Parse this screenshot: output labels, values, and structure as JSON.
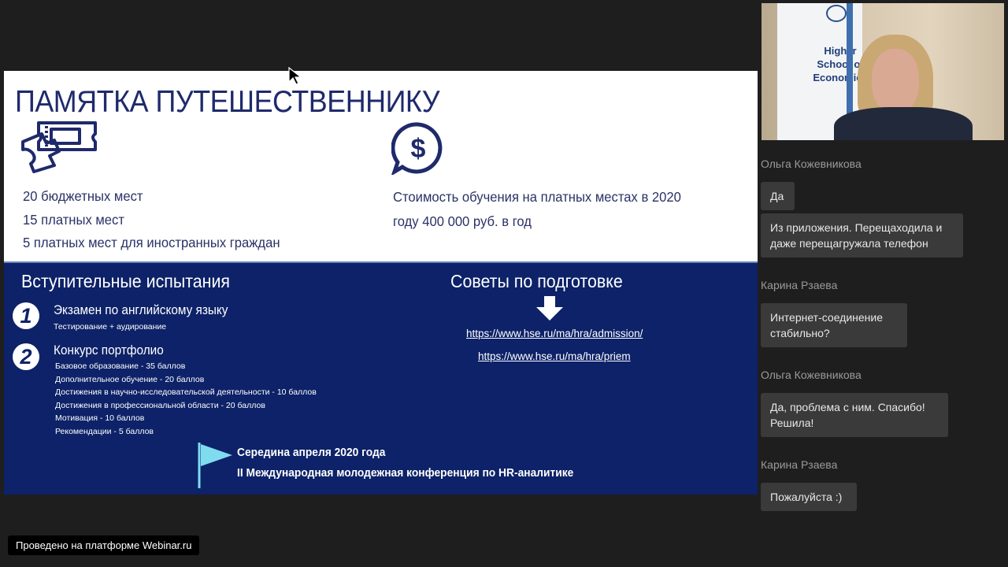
{
  "slide": {
    "title": "ПАМЯТКА ПУТЕШЕСТВЕННИКУ",
    "seats": [
      "20 бюджетных мест",
      "15 платных мест",
      "5 платных мест для иностранных граждан"
    ],
    "cost": [
      "Стоимость обучения на платных местах в 2020",
      "году 400 000 руб. в год"
    ],
    "exams_title": "Вступительные испытания",
    "exam1_number": "1",
    "exam1_head": "Экзамен по английскому языку",
    "exam1_sub": "Тестирование + аудирование",
    "exam2_number": "2",
    "exam2_head": "Конкурс портфолио",
    "portfolio": [
      "Базовое образование - 35 баллов",
      "Дополнительное обучение - 20 баллов",
      "Достижения в научно-исследовательской деятельности - 10 баллов",
      "Достижения в профессиональной области - 20 баллов",
      "Мотивация -  10 баллов",
      "Рекомендации - 5 баллов"
    ],
    "tips_title": "Советы по подготовке",
    "links": [
      "https://www.hse.ru/ma/hra/admission/",
      "https://www.hse.ru/ma/hra/priem"
    ],
    "event": [
      "Середина апреля 2020 года",
      "II Международная молодежная конференция по HR-аналитике"
    ],
    "dollar_symbol": "$"
  },
  "video": {
    "banner_text": [
      "Higher",
      "School of",
      "Economics"
    ]
  },
  "chat": [
    {
      "type": "name",
      "text": "Ольга Кожевникова"
    },
    {
      "type": "msg",
      "lines": [
        "Да"
      ]
    },
    {
      "type": "msg",
      "lines": [
        "Из приложения. Перещаходила и",
        "даже перещагружала телефон"
      ]
    },
    {
      "type": "name",
      "text": "Карина Рзаева"
    },
    {
      "type": "msg",
      "lines": [
        "Интернет-соединение",
        "стабильно?"
      ]
    },
    {
      "type": "name",
      "text": "Ольга Кожевникова"
    },
    {
      "type": "msg",
      "lines": [
        "Да, проблема с ним. Спасибо!",
        "Решила!"
      ]
    },
    {
      "type": "name",
      "text": "Карина Рзаева"
    },
    {
      "type": "msg",
      "lines": [
        "Пожалуйста :)"
      ]
    }
  ],
  "footer": {
    "badge": "Проведено на платформе Webinar.ru"
  },
  "colors": {
    "slide_navy": "#0d2268",
    "slide_text": "#1f2a6b",
    "background": "#1e1e1e",
    "bubble": "#3a3a3a"
  }
}
